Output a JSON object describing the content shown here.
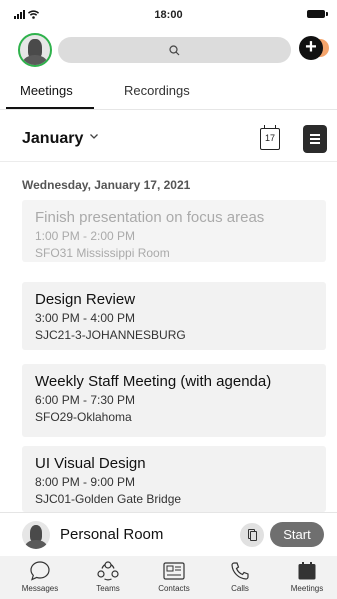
{
  "status_bar": {
    "time": "18:00"
  },
  "tabs": [
    {
      "label": "Meetings",
      "active": true
    },
    {
      "label": "Recordings",
      "active": false
    }
  ],
  "month_selector": {
    "label": "January"
  },
  "calendar_button": {
    "day": "17"
  },
  "date_header": "Wednesday, January 17, 2021",
  "meetings": [
    {
      "title": "Finish presentation on focus areas",
      "time": "1:00 PM - 2:00 PM",
      "location": "SFO31 Mississippi Room",
      "past": true
    },
    {
      "title": "Design Review",
      "time": "3:00 PM - 4:00 PM",
      "location": "SJC21-3-JOHANNESBURG",
      "past": false
    },
    {
      "title": "Weekly Staff Meeting (with agenda)",
      "time": "6:00 PM - 7:30 PM",
      "location": "SFO29-Oklahoma",
      "past": false
    },
    {
      "title": "UI Visual Design",
      "time": "8:00 PM - 9:00 PM",
      "location": "SJC01-Golden Gate Bridge",
      "past": false
    }
  ],
  "personal_room": {
    "label": "Personal Room",
    "start_label": "Start"
  },
  "bottom_nav": [
    {
      "label": "Messages",
      "icon": "chat-bubble-icon"
    },
    {
      "label": "Teams",
      "icon": "teams-icon"
    },
    {
      "label": "Contacts",
      "icon": "contact-card-icon"
    },
    {
      "label": "Calls",
      "icon": "phone-icon"
    },
    {
      "label": "Meetings",
      "icon": "calendar-icon",
      "active": true
    }
  ],
  "colors": {
    "presence": "#2fb24c",
    "accent_dark": "#111111",
    "start_button": "#6f6f6f",
    "add_badge": "#f4a46b"
  }
}
